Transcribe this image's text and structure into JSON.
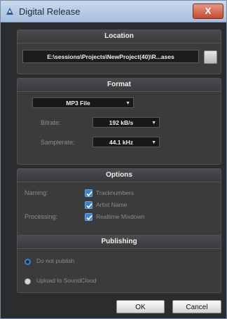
{
  "window": {
    "title": "Digital Release",
    "close_label": "X"
  },
  "location": {
    "heading": "Location",
    "path": "E:\\sessions\\Projects\\NewProject(40)\\R...ases"
  },
  "format": {
    "heading": "Format",
    "file_type": "MP3 File",
    "bitrate_label": "Bitrate:",
    "bitrate_value": "192 kB/s",
    "samplerate_label": "Samplerate:",
    "samplerate_value": "44.1 kHz"
  },
  "options": {
    "heading": "Options",
    "naming_label": "Naming:",
    "tracknumbers_label": "Tracknumbers",
    "artistname_label": "Artist Name",
    "processing_label": "Processing:",
    "realtime_label": "Realtime Mixdown",
    "tracknumbers_checked": true,
    "artistname_checked": true,
    "realtime_checked": true
  },
  "publishing": {
    "heading": "Publishing",
    "opt_none_label": "Do not publish",
    "opt_soundcloud_label": "Upload to SoundCloud",
    "selected": "Do not publish"
  },
  "buttons": {
    "ok": "OK",
    "cancel": "Cancel"
  },
  "colors": {
    "accent": "#3c84c8",
    "panel": "#3a3b3d",
    "background": "#2b2c2e"
  }
}
